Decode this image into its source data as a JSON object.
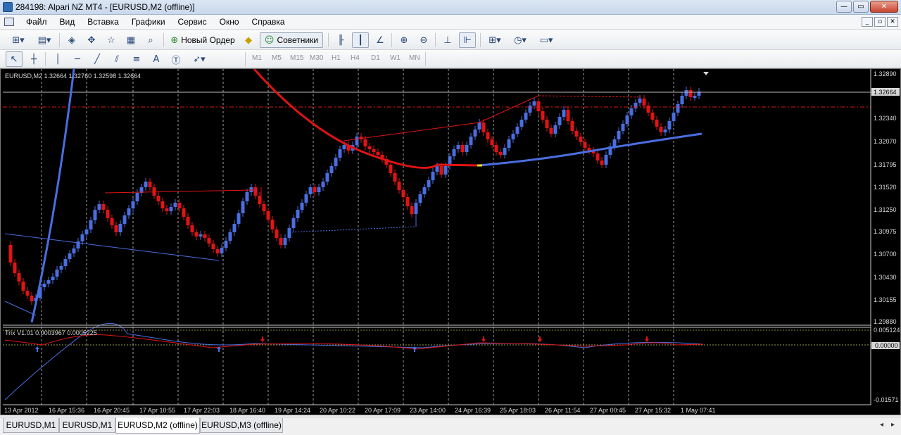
{
  "window": {
    "title": "284198: Alpari NZ MT4 - [EURUSD,M2 (offline)]",
    "controls": [
      "—",
      "▭",
      "✕"
    ]
  },
  "menu": {
    "items": [
      "Файл",
      "Вид",
      "Вставка",
      "Графики",
      "Сервис",
      "Окно",
      "Справка"
    ],
    "mdi_controls": [
      "_",
      "▫",
      "✕"
    ]
  },
  "toolbar": {
    "new_order_label": "Новый Ордер",
    "advisors_label": "Советники",
    "timeframes": [
      "M1",
      "M5",
      "M15",
      "M30",
      "H1",
      "H4",
      "D1",
      "W1",
      "MN"
    ]
  },
  "chart": {
    "header": "EURUSD,M2  1.32664 1.32760 1.32598 1.32664",
    "indicator_header": "Trix V1.01 0.0003967 0.0005225",
    "current_price": "1.32664",
    "price_labels": [
      "1.32890",
      "1.32340",
      "1.32070",
      "1.31795",
      "1.31520",
      "1.31250",
      "1.30975",
      "1.30700",
      "1.30430",
      "1.30155",
      "1.29880"
    ],
    "indicator_labels": [
      "0.005124",
      "0.00000",
      "-0.01571"
    ],
    "time_labels": [
      "13 Apr 2012",
      "16 Apr 15:36",
      "16 Apr 20:45",
      "17 Apr 10:55",
      "17 Apr 22:03",
      "18 Apr 16:40",
      "19 Apr 14:24",
      "20 Apr 10:22",
      "20 Apr 17:09",
      "23 Apr 14:00",
      "24 Apr 16:39",
      "25 Apr 18:03",
      "26 Apr 11:54",
      "27 Apr 00:45",
      "27 Apr 15:32",
      "1 May 07:41"
    ],
    "colors": {
      "bull": "#4a6ee0",
      "bear": "#e01414",
      "ma_red": "#e01414",
      "ma_blue": "#4a6ee0",
      "grid": "#c8c8c8"
    }
  },
  "tabs": {
    "items": [
      "EURUSD,M1",
      "EURUSD,M1",
      "EURUSD,M2 (offline)",
      "EURUSD,M3 (offline)"
    ],
    "active_index": 2
  }
}
